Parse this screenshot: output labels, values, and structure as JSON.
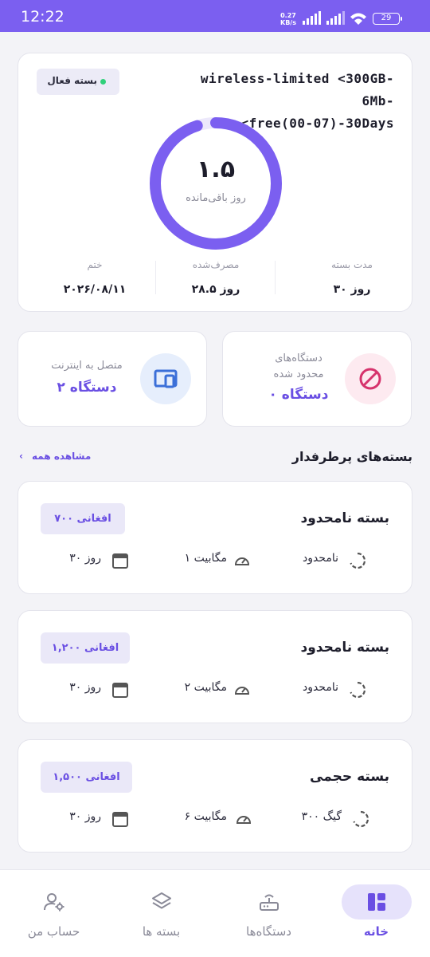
{
  "status_bar": {
    "time": "12:22",
    "net_speed": "0.27",
    "net_unit": "KB/s",
    "battery": "29"
  },
  "active_plan": {
    "status": "بسته فعال",
    "name_line1": "wireless-limited <300GB-6Mb-",
    "name_line2": "<free(00-07)-30Days",
    "remaining_value": "۱.۵",
    "remaining_label": "روز باقی‌مانده",
    "remaining_fraction": 0.95,
    "stats": [
      {
        "label": "مدت بسته",
        "value": "۳۰ روز"
      },
      {
        "label": "مصرف‌شده",
        "value": "۲۸.۵ روز"
      },
      {
        "label": "ختم",
        "value": "۲۰۲۶/۰۸/۱۱"
      }
    ]
  },
  "devices": {
    "blocked": {
      "title_line1": "دستگاه‌های",
      "title_line2": "محدود شده",
      "value": "۰ دستگاه",
      "color": "#d6336c"
    },
    "connected": {
      "title": "متصل به اینترنت",
      "value": "۲ دستگاه",
      "color": "#3b6fd8"
    }
  },
  "popular": {
    "title": "بسته‌های پرطرفدار",
    "see_all": "مشاهده همه",
    "packages": [
      {
        "name": "بسته نامحدود",
        "price": "۷۰۰ افغانی",
        "volume": "نامحدود",
        "speed": "۱ مگابیت",
        "duration": "۳۰ روز"
      },
      {
        "name": "بسته نامحدود",
        "price": "۱,۲۰۰ افغانی",
        "volume": "نامحدود",
        "speed": "۲ مگابیت",
        "duration": "۳۰ روز"
      },
      {
        "name": "بسته حجمی",
        "price": "۱,۵۰۰ افغانی",
        "volume": "۳۰۰ گیگ",
        "speed": "۶ مگابیت",
        "duration": "۳۰ روز"
      }
    ]
  },
  "nav": [
    {
      "label": "خانه",
      "icon": "dashboard-icon",
      "active": true
    },
    {
      "label": "دستگاه‌ها",
      "icon": "router-icon",
      "active": false
    },
    {
      "label": "بسته ها",
      "icon": "layers-icon",
      "active": false
    },
    {
      "label": "حساب من",
      "icon": "user-settings-icon",
      "active": false
    }
  ],
  "colors": {
    "accent": "#6a4fe3",
    "ring": "#7b5ff0",
    "statusbar": "#7b5ff0"
  }
}
